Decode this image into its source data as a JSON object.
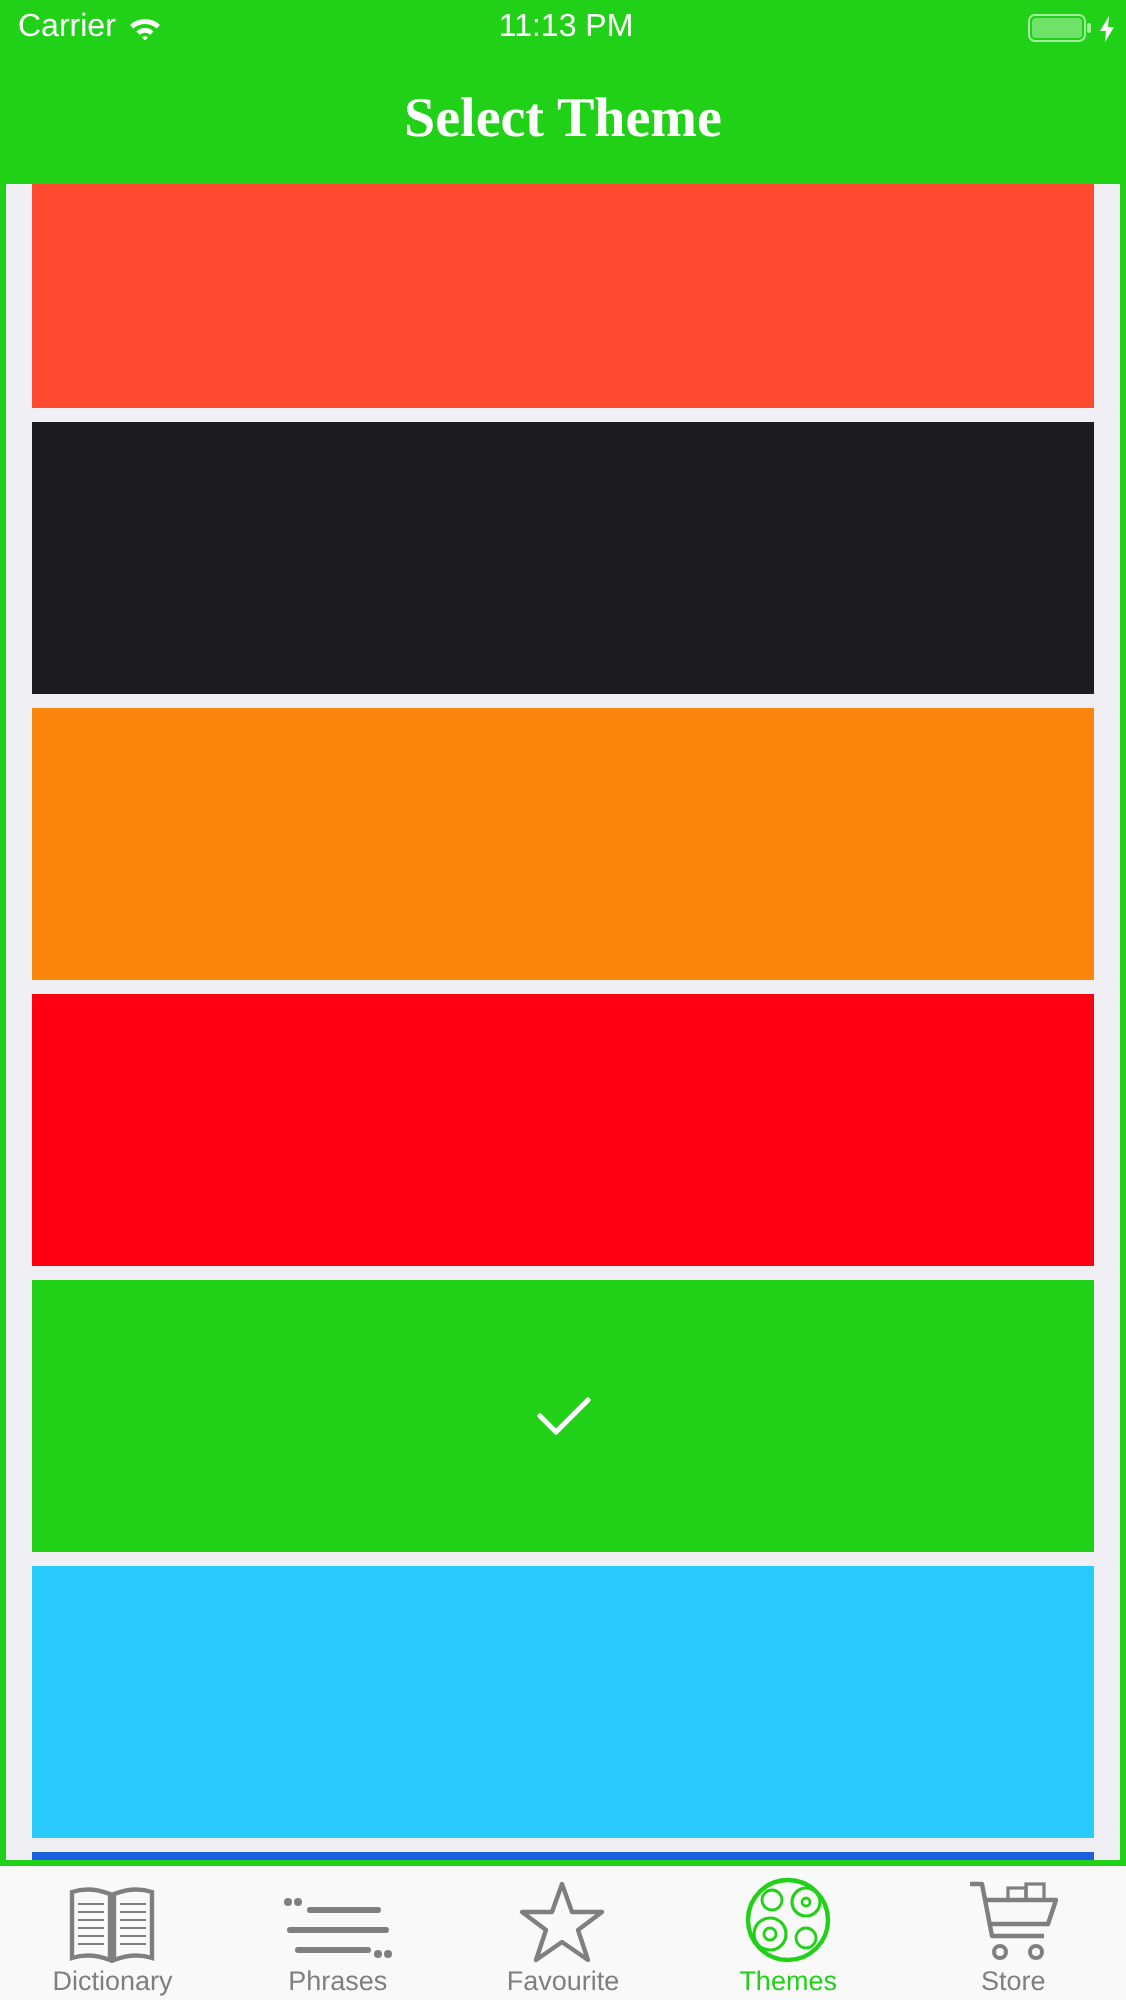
{
  "status_bar": {
    "carrier": "Carrier",
    "time": "11:13 PM"
  },
  "nav_bar": {
    "title": "Select Theme"
  },
  "themes": [
    {
      "color": "#ff4a30",
      "selected": false
    },
    {
      "color": "#1c1c21",
      "selected": false
    },
    {
      "color": "#fc850d",
      "selected": false
    },
    {
      "color": "#ff0012",
      "selected": false
    },
    {
      "color": "#21d118",
      "selected": true
    },
    {
      "color": "#29cbfc",
      "selected": false
    },
    {
      "color": "#1a5fe0"
    }
  ],
  "tab_bar": [
    {
      "label": "Dictionary",
      "selected": false
    },
    {
      "label": "Phrases",
      "selected": false
    },
    {
      "label": "Favourite",
      "selected": false
    },
    {
      "label": "Themes",
      "selected": true
    },
    {
      "label": "Store",
      "selected": false
    }
  ]
}
